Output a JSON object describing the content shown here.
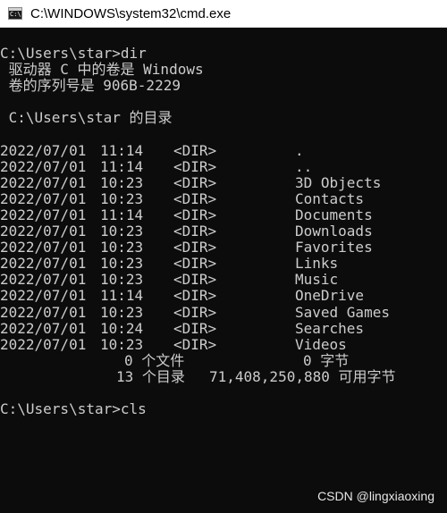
{
  "window": {
    "title": "C:\\WINDOWS\\system32\\cmd.exe",
    "icon_text": "C:\\",
    "icon": "cmd-icon"
  },
  "console": {
    "prompt_dir": "C:\\Users\\star>dir",
    "volume_line": " 驱动器 C 中的卷是 Windows",
    "serial_line": " 卷的序列号是 906B-2229",
    "dir_of_line": " C:\\Users\\star 的目录",
    "entries": [
      {
        "date": "2022/07/01",
        "time": "11:14",
        "type": "<DIR>",
        "name": "."
      },
      {
        "date": "2022/07/01",
        "time": "11:14",
        "type": "<DIR>",
        "name": ".."
      },
      {
        "date": "2022/07/01",
        "time": "10:23",
        "type": "<DIR>",
        "name": "3D Objects"
      },
      {
        "date": "2022/07/01",
        "time": "10:23",
        "type": "<DIR>",
        "name": "Contacts"
      },
      {
        "date": "2022/07/01",
        "time": "11:14",
        "type": "<DIR>",
        "name": "Documents"
      },
      {
        "date": "2022/07/01",
        "time": "10:23",
        "type": "<DIR>",
        "name": "Downloads"
      },
      {
        "date": "2022/07/01",
        "time": "10:23",
        "type": "<DIR>",
        "name": "Favorites"
      },
      {
        "date": "2022/07/01",
        "time": "10:23",
        "type": "<DIR>",
        "name": "Links"
      },
      {
        "date": "2022/07/01",
        "time": "10:23",
        "type": "<DIR>",
        "name": "Music"
      },
      {
        "date": "2022/07/01",
        "time": "11:14",
        "type": "<DIR>",
        "name": "OneDrive"
      },
      {
        "date": "2022/07/01",
        "time": "10:23",
        "type": "<DIR>",
        "name": "Saved Games"
      },
      {
        "date": "2022/07/01",
        "time": "10:24",
        "type": "<DIR>",
        "name": "Searches"
      },
      {
        "date": "2022/07/01",
        "time": "10:23",
        "type": "<DIR>",
        "name": "Videos"
      }
    ],
    "files_count": "0 个文件",
    "files_bytes": "0 字节",
    "dirs_count": "13 个目录",
    "dirs_free": "71,408,250,880 可用字节",
    "prompt_cls": "C:\\Users\\star>cls"
  },
  "watermark": "CSDN @lingxiaoxing",
  "colors": {
    "background": "#0c0c0c",
    "text": "#cccccc",
    "titlebar": "#ffffff"
  }
}
